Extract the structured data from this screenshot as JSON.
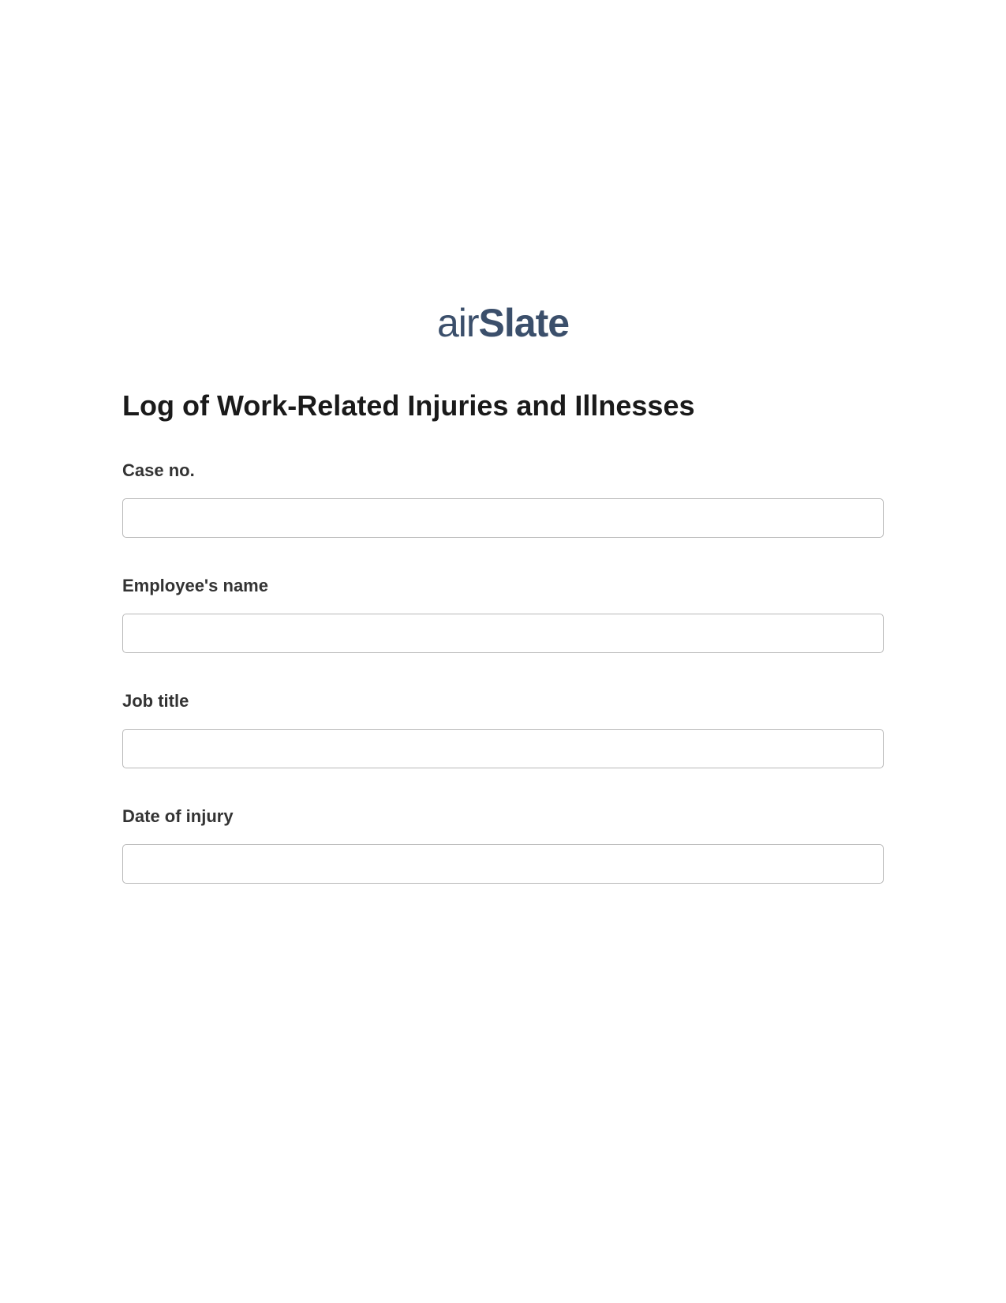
{
  "logo": {
    "prefix": "air",
    "suffix": "Slate"
  },
  "form": {
    "title": "Log of Work-Related Injuries and Illnesses",
    "fields": [
      {
        "label": "Case no.",
        "value": ""
      },
      {
        "label": "Employee's name",
        "value": ""
      },
      {
        "label": "Job title",
        "value": ""
      },
      {
        "label": "Date of injury",
        "value": ""
      }
    ]
  }
}
